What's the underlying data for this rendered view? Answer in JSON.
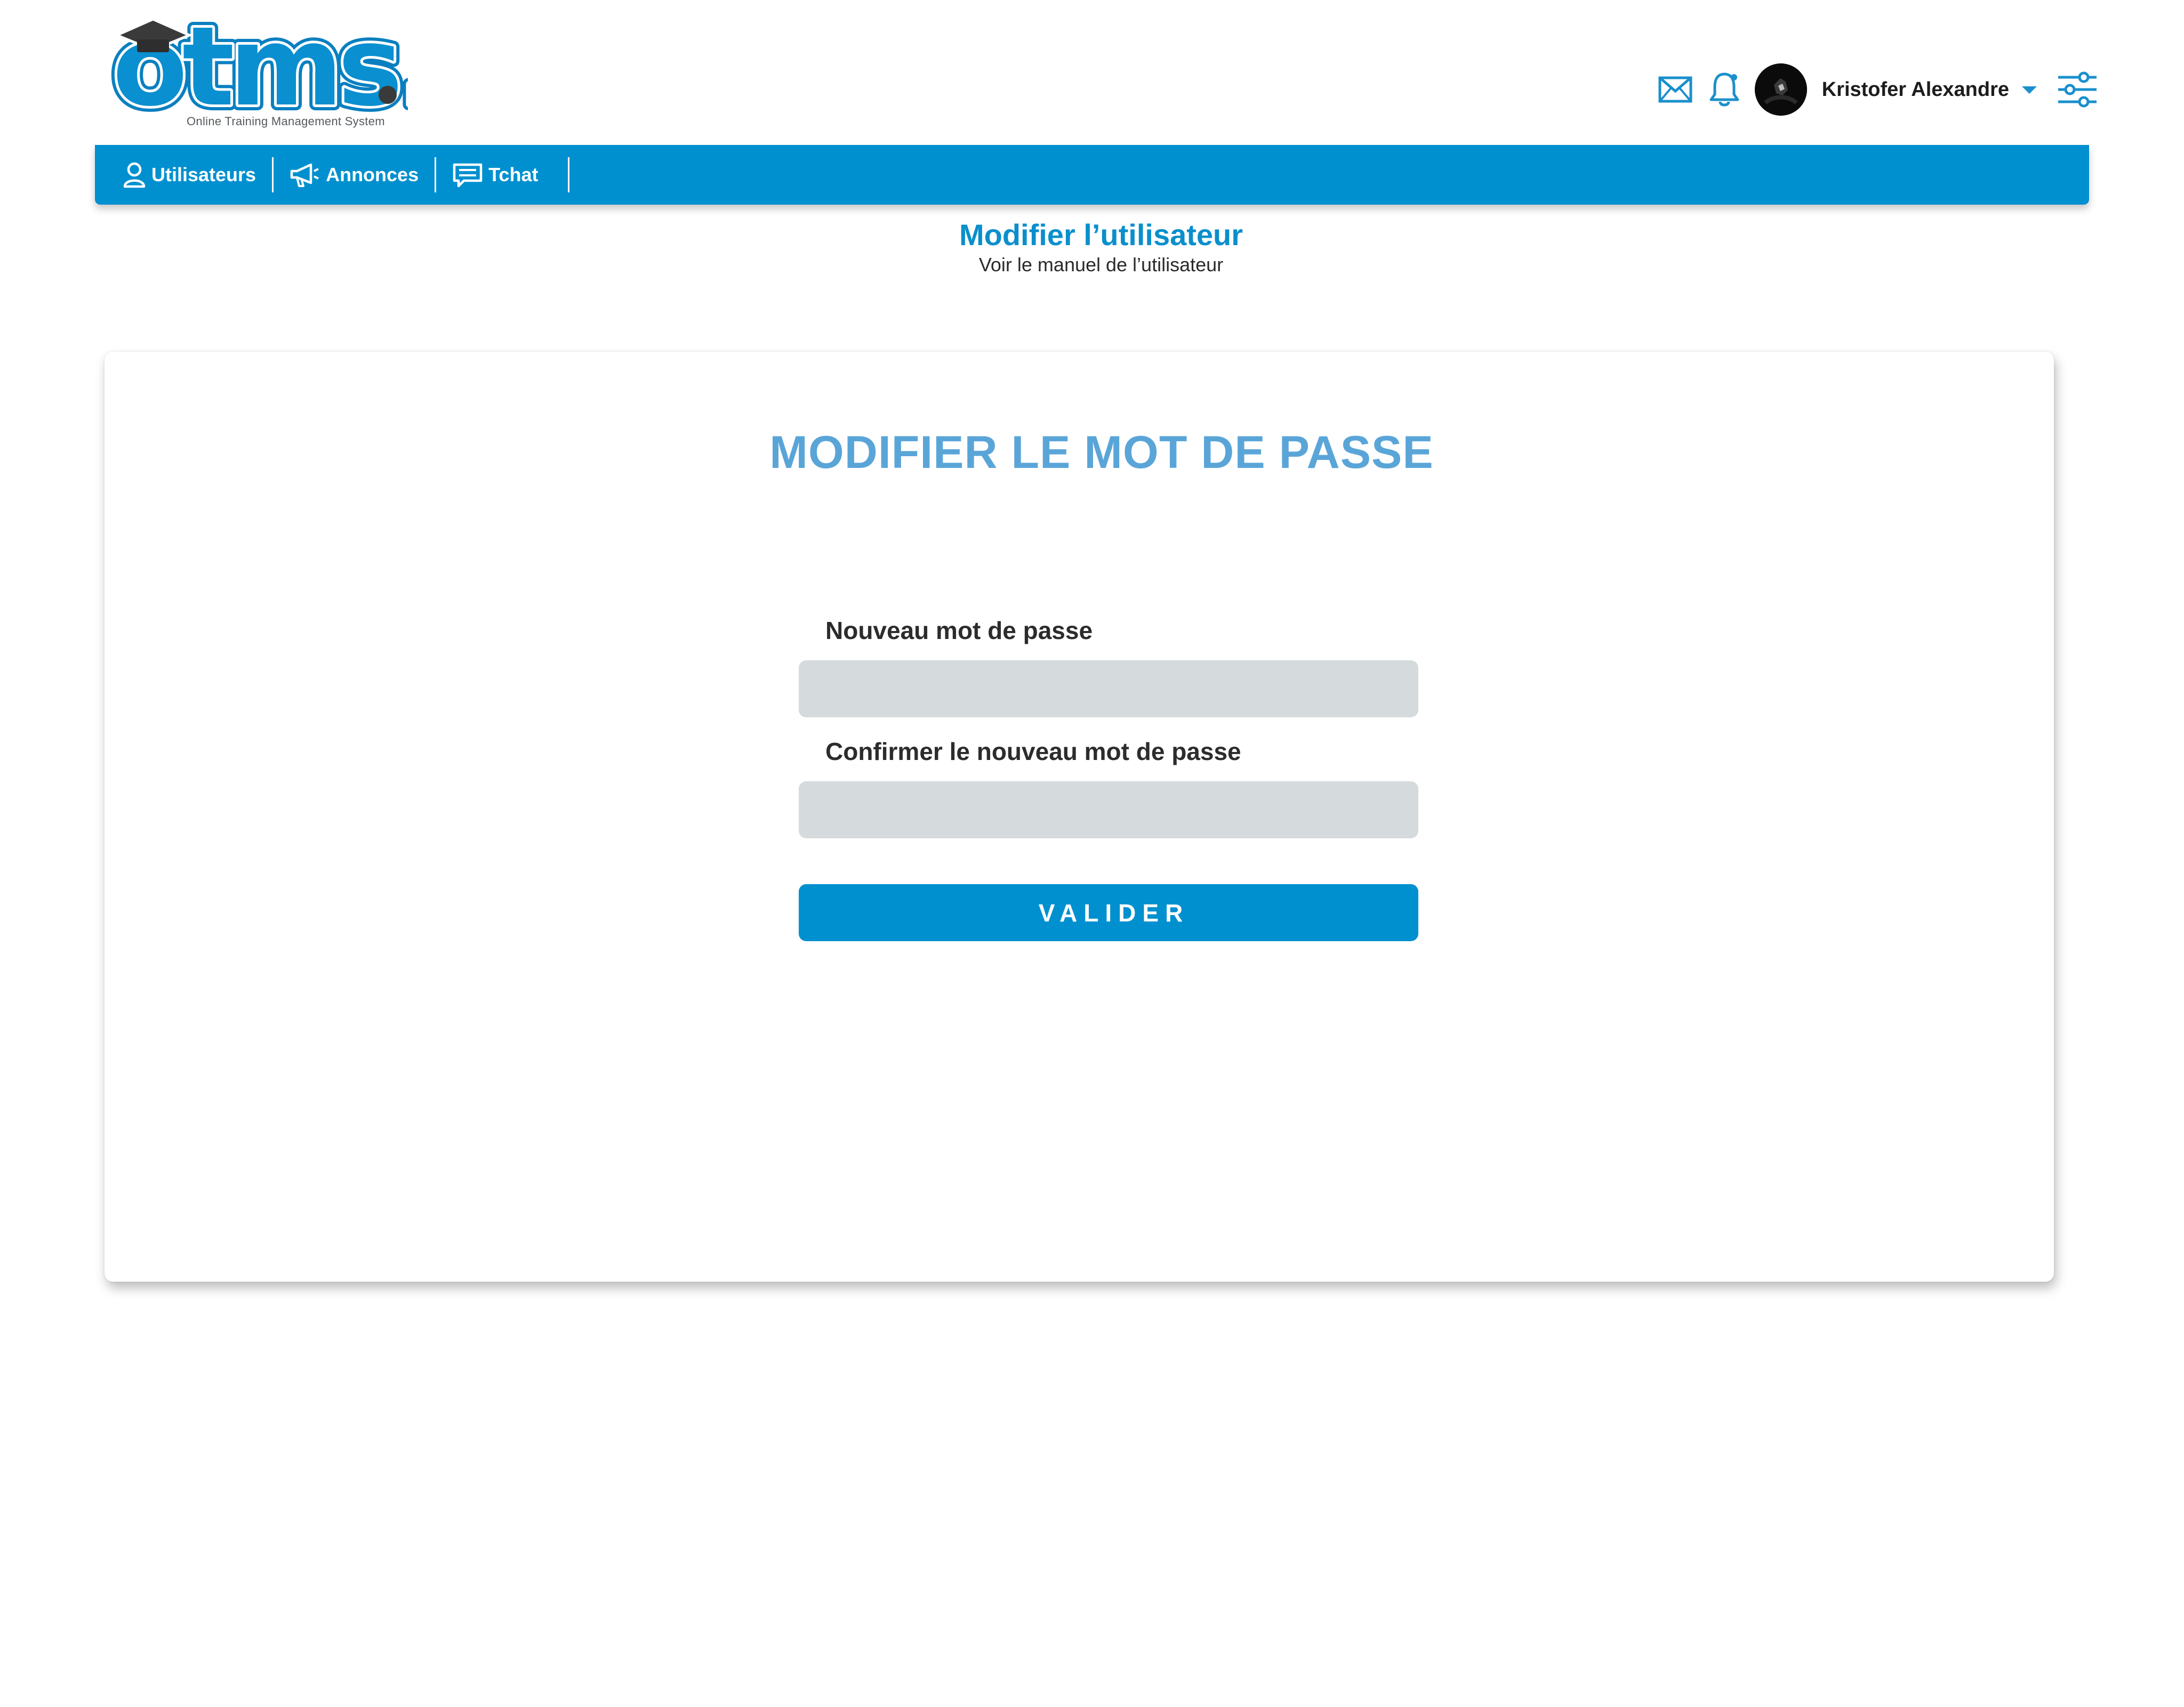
{
  "brand": {
    "logo_text": "otms.",
    "tagline": "Online Training Management System"
  },
  "header": {
    "user_name": "Kristofer Alexandre",
    "icons": [
      "mail-icon",
      "bell-icon",
      "avatar",
      "caret-down-icon",
      "filters-icon"
    ]
  },
  "nav": {
    "items": [
      {
        "label": "Utilisateurs",
        "icon": "user-icon"
      },
      {
        "label": "Annonces",
        "icon": "megaphone-icon"
      },
      {
        "label": "Tchat",
        "icon": "chat-icon"
      }
    ]
  },
  "page": {
    "title": "Modifier l’utilisateur",
    "subtitle": "Voir le manuel de l’utilisateur"
  },
  "form": {
    "title": "MODIFIER LE MOT DE PASSE",
    "new_password_label": "Nouveau mot de passe",
    "new_password_value": "",
    "confirm_password_label": "Confirmer le nouveau mot de passe",
    "confirm_password_value": "",
    "submit_label": "VALIDER"
  },
  "colors": {
    "primary": "#0090cf",
    "title_blue": "#0a8fcc",
    "card_title": "#5aa5d8",
    "input_bg": "#d5dbdc",
    "text_dark": "#2c2c2c"
  }
}
